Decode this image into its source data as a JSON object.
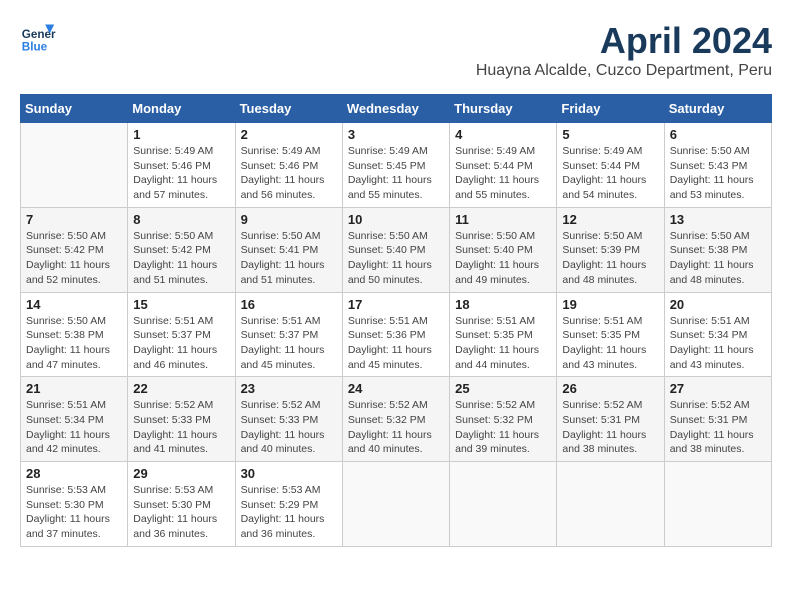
{
  "header": {
    "logo_general": "General",
    "logo_blue": "Blue",
    "title": "April 2024",
    "subtitle": "Huayna Alcalde, Cuzco Department, Peru"
  },
  "weekdays": [
    "Sunday",
    "Monday",
    "Tuesday",
    "Wednesday",
    "Thursday",
    "Friday",
    "Saturday"
  ],
  "weeks": [
    [
      {
        "day": "",
        "info": ""
      },
      {
        "day": "1",
        "info": "Sunrise: 5:49 AM\nSunset: 5:46 PM\nDaylight: 11 hours\nand 57 minutes."
      },
      {
        "day": "2",
        "info": "Sunrise: 5:49 AM\nSunset: 5:46 PM\nDaylight: 11 hours\nand 56 minutes."
      },
      {
        "day": "3",
        "info": "Sunrise: 5:49 AM\nSunset: 5:45 PM\nDaylight: 11 hours\nand 55 minutes."
      },
      {
        "day": "4",
        "info": "Sunrise: 5:49 AM\nSunset: 5:44 PM\nDaylight: 11 hours\nand 55 minutes."
      },
      {
        "day": "5",
        "info": "Sunrise: 5:49 AM\nSunset: 5:44 PM\nDaylight: 11 hours\nand 54 minutes."
      },
      {
        "day": "6",
        "info": "Sunrise: 5:50 AM\nSunset: 5:43 PM\nDaylight: 11 hours\nand 53 minutes."
      }
    ],
    [
      {
        "day": "7",
        "info": "Sunrise: 5:50 AM\nSunset: 5:42 PM\nDaylight: 11 hours\nand 52 minutes."
      },
      {
        "day": "8",
        "info": "Sunrise: 5:50 AM\nSunset: 5:42 PM\nDaylight: 11 hours\nand 51 minutes."
      },
      {
        "day": "9",
        "info": "Sunrise: 5:50 AM\nSunset: 5:41 PM\nDaylight: 11 hours\nand 51 minutes."
      },
      {
        "day": "10",
        "info": "Sunrise: 5:50 AM\nSunset: 5:40 PM\nDaylight: 11 hours\nand 50 minutes."
      },
      {
        "day": "11",
        "info": "Sunrise: 5:50 AM\nSunset: 5:40 PM\nDaylight: 11 hours\nand 49 minutes."
      },
      {
        "day": "12",
        "info": "Sunrise: 5:50 AM\nSunset: 5:39 PM\nDaylight: 11 hours\nand 48 minutes."
      },
      {
        "day": "13",
        "info": "Sunrise: 5:50 AM\nSunset: 5:38 PM\nDaylight: 11 hours\nand 48 minutes."
      }
    ],
    [
      {
        "day": "14",
        "info": "Sunrise: 5:50 AM\nSunset: 5:38 PM\nDaylight: 11 hours\nand 47 minutes."
      },
      {
        "day": "15",
        "info": "Sunrise: 5:51 AM\nSunset: 5:37 PM\nDaylight: 11 hours\nand 46 minutes."
      },
      {
        "day": "16",
        "info": "Sunrise: 5:51 AM\nSunset: 5:37 PM\nDaylight: 11 hours\nand 45 minutes."
      },
      {
        "day": "17",
        "info": "Sunrise: 5:51 AM\nSunset: 5:36 PM\nDaylight: 11 hours\nand 45 minutes."
      },
      {
        "day": "18",
        "info": "Sunrise: 5:51 AM\nSunset: 5:35 PM\nDaylight: 11 hours\nand 44 minutes."
      },
      {
        "day": "19",
        "info": "Sunrise: 5:51 AM\nSunset: 5:35 PM\nDaylight: 11 hours\nand 43 minutes."
      },
      {
        "day": "20",
        "info": "Sunrise: 5:51 AM\nSunset: 5:34 PM\nDaylight: 11 hours\nand 43 minutes."
      }
    ],
    [
      {
        "day": "21",
        "info": "Sunrise: 5:51 AM\nSunset: 5:34 PM\nDaylight: 11 hours\nand 42 minutes."
      },
      {
        "day": "22",
        "info": "Sunrise: 5:52 AM\nSunset: 5:33 PM\nDaylight: 11 hours\nand 41 minutes."
      },
      {
        "day": "23",
        "info": "Sunrise: 5:52 AM\nSunset: 5:33 PM\nDaylight: 11 hours\nand 40 minutes."
      },
      {
        "day": "24",
        "info": "Sunrise: 5:52 AM\nSunset: 5:32 PM\nDaylight: 11 hours\nand 40 minutes."
      },
      {
        "day": "25",
        "info": "Sunrise: 5:52 AM\nSunset: 5:32 PM\nDaylight: 11 hours\nand 39 minutes."
      },
      {
        "day": "26",
        "info": "Sunrise: 5:52 AM\nSunset: 5:31 PM\nDaylight: 11 hours\nand 38 minutes."
      },
      {
        "day": "27",
        "info": "Sunrise: 5:52 AM\nSunset: 5:31 PM\nDaylight: 11 hours\nand 38 minutes."
      }
    ],
    [
      {
        "day": "28",
        "info": "Sunrise: 5:53 AM\nSunset: 5:30 PM\nDaylight: 11 hours\nand 37 minutes."
      },
      {
        "day": "29",
        "info": "Sunrise: 5:53 AM\nSunset: 5:30 PM\nDaylight: 11 hours\nand 36 minutes."
      },
      {
        "day": "30",
        "info": "Sunrise: 5:53 AM\nSunset: 5:29 PM\nDaylight: 11 hours\nand 36 minutes."
      },
      {
        "day": "",
        "info": ""
      },
      {
        "day": "",
        "info": ""
      },
      {
        "day": "",
        "info": ""
      },
      {
        "day": "",
        "info": ""
      }
    ]
  ]
}
